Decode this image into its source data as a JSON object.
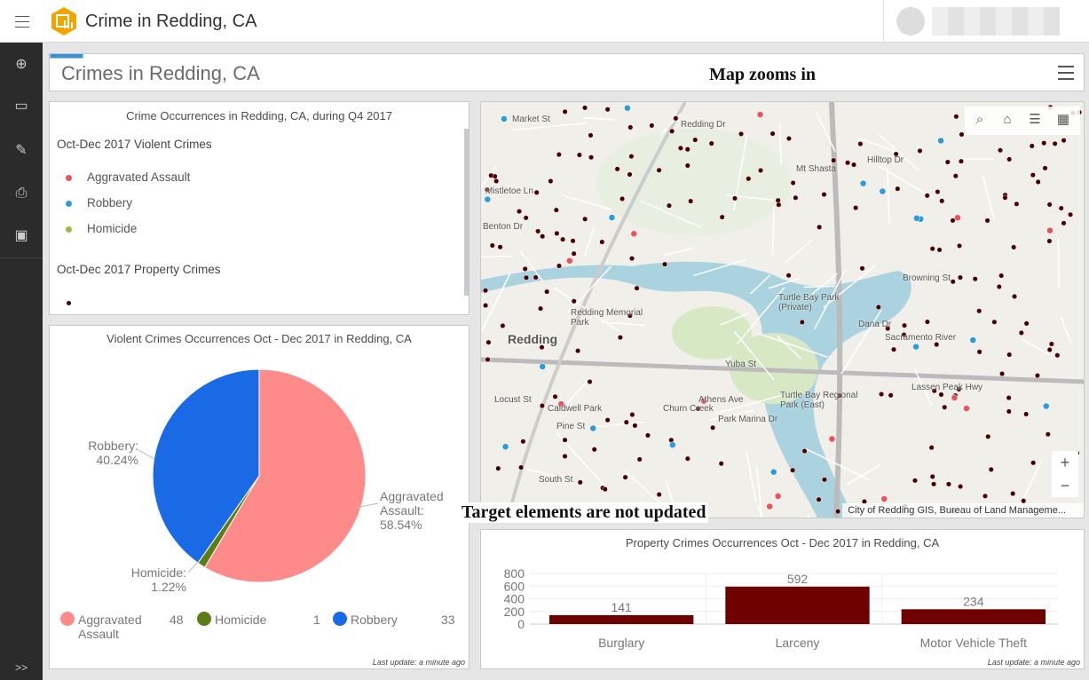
{
  "app": {
    "title": "Crime in Redding, CA",
    "brand_color": "#f0a500"
  },
  "header": {
    "title": "Crimes in Redding, CA"
  },
  "sidebar": {
    "icons": [
      "add-icon",
      "monitor-icon",
      "preview-icon",
      "print-icon",
      "save-icon"
    ],
    "expand_label": ">>"
  },
  "annotations": {
    "map_note": "Map zooms in",
    "target_note": "Target elements are not updated"
  },
  "legend_panel": {
    "title": "Crime Occurrences in Redding, CA, during Q4 2017",
    "violent_heading": "Oct-Dec 2017 Violent Crimes",
    "violent_items": [
      {
        "label": "Aggravated Assault",
        "color": "#e8545a"
      },
      {
        "label": "Robbery",
        "color": "#2e9bd6"
      },
      {
        "label": "Homicide",
        "color": "#9bb93a"
      }
    ],
    "property_heading": "Oct-Dec 2017 Property Crimes",
    "property_color": "#4a0000"
  },
  "map": {
    "attribution": "City of Redding GIS, Bureau of Land Manageme...",
    "labels": [
      "Redding",
      "Turtle Bay Park (Private)",
      "Turtle Bay Regional Park (East)",
      "Redding Memorial Park",
      "Browning St",
      "Lassen Peak Hwy",
      "Market St",
      "Mistletoe Ln",
      "Benton Dr",
      "Caldwell Park",
      "Pine St",
      "South St",
      "Locust St",
      "Yuba St",
      "Sacramento River",
      "Dana Dr",
      "Mt Shasta",
      "Redding Dr",
      "Hilltop Dr",
      "Churn Creek",
      "Athens Ave",
      "Park Marina Dr"
    ],
    "zoom_in": "+",
    "zoom_out": "−",
    "tools": [
      "search-icon",
      "home-icon",
      "layer-list-icon",
      "basemap-gallery-icon"
    ]
  },
  "chart_data": [
    {
      "type": "pie",
      "title": "Violent Crimes Occurrences Oct - Dec 2017 in Redding, CA",
      "slices": [
        {
          "label": "Aggravated Assault",
          "value": 48,
          "percent": "58.54%",
          "color": "#ff8a8a"
        },
        {
          "label": "Homicide",
          "value": 1,
          "percent": "1.22%",
          "color": "#5a7d16"
        },
        {
          "label": "Robbery",
          "value": 33,
          "percent": "40.24%",
          "color": "#1a6ae6"
        }
      ],
      "last_update": "Last update: a minute ago"
    },
    {
      "type": "bar",
      "title": "Property Crimes Occurrences Oct - Dec 2017 in Redding, CA",
      "categories": [
        "Burglary",
        "Larceny",
        "Motor Vehicle Theft"
      ],
      "values": [
        141,
        592,
        234
      ],
      "ylim": [
        0,
        800
      ],
      "yticks": [
        0,
        200,
        400,
        600,
        800
      ],
      "color": "#6e0000",
      "grid": true,
      "last_update": "Last update: a minute ago"
    }
  ]
}
